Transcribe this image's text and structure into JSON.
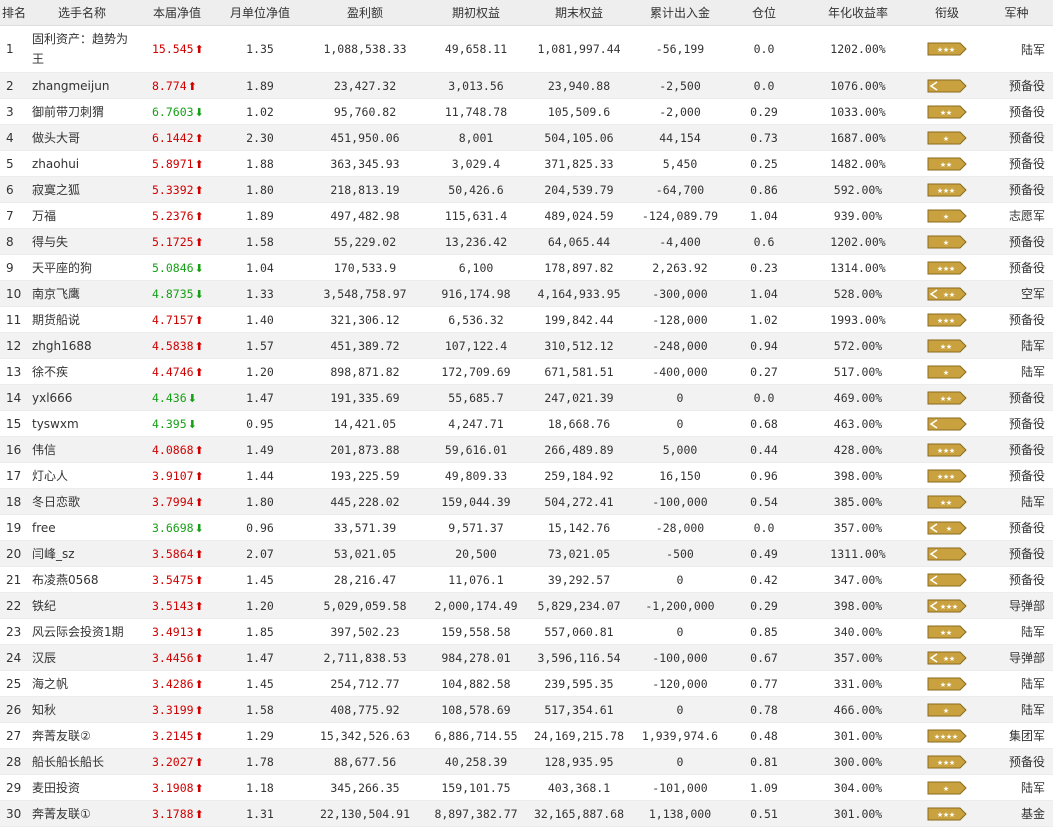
{
  "headers": [
    "排名",
    "选手名称",
    "本届净值",
    "月单位净值",
    "盈利额",
    "期初权益",
    "期末权益",
    "累计出入金",
    "仓位",
    "年化收益率",
    "衔级",
    "军种"
  ],
  "colors": {
    "up": "#d00000",
    "down": "#16a016",
    "badge_fill": "#c9a23f",
    "badge_edge": "#8a6a1f"
  },
  "rows": [
    {
      "rank": "1",
      "name": "固利资产：趋势为王",
      "nav": "15.545",
      "dir": "up",
      "monthly": "1.35",
      "profit": "1,088,538.33",
      "start": "49,658.11",
      "end": "1,081,997.44",
      "flow": "-56,199",
      "position": "0.0",
      "annual": "1202.00%",
      "insignia": {
        "chevron": false,
        "stars": 3
      },
      "arm": "陆军"
    },
    {
      "rank": "2",
      "name": "zhangmeijun",
      "nav": "8.774",
      "dir": "up",
      "monthly": "1.89",
      "profit": "23,427.32",
      "start": "3,013.56",
      "end": "23,940.88",
      "flow": "-2,500",
      "position": "0.0",
      "annual": "1076.00%",
      "insignia": {
        "chevron": true,
        "stars": 0
      },
      "arm": "预备役"
    },
    {
      "rank": "3",
      "name": "御前带刀刺猬",
      "nav": "6.7603",
      "dir": "down",
      "monthly": "1.02",
      "profit": "95,760.82",
      "start": "11,748.78",
      "end": "105,509.6",
      "flow": "-2,000",
      "position": "0.29",
      "annual": "1033.00%",
      "insignia": {
        "chevron": false,
        "stars": 2
      },
      "arm": "预备役"
    },
    {
      "rank": "4",
      "name": "做头大哥",
      "nav": "6.1442",
      "dir": "up",
      "monthly": "2.30",
      "profit": "451,950.06",
      "start": "8,001",
      "end": "504,105.06",
      "flow": "44,154",
      "position": "0.73",
      "annual": "1687.00%",
      "insignia": {
        "chevron": false,
        "stars": 1
      },
      "arm": "预备役"
    },
    {
      "rank": "5",
      "name": "zhaohui",
      "nav": "5.8971",
      "dir": "up",
      "monthly": "1.88",
      "profit": "363,345.93",
      "start": "3,029.4",
      "end": "371,825.33",
      "flow": "5,450",
      "position": "0.25",
      "annual": "1482.00%",
      "insignia": {
        "chevron": false,
        "stars": 2
      },
      "arm": "预备役"
    },
    {
      "rank": "6",
      "name": "寂寞之狐",
      "nav": "5.3392",
      "dir": "up",
      "monthly": "1.80",
      "profit": "218,813.19",
      "start": "50,426.6",
      "end": "204,539.79",
      "flow": "-64,700",
      "position": "0.86",
      "annual": "592.00%",
      "insignia": {
        "chevron": false,
        "stars": 3
      },
      "arm": "预备役"
    },
    {
      "rank": "7",
      "name": "万福",
      "nav": "5.2376",
      "dir": "up",
      "monthly": "1.89",
      "profit": "497,482.98",
      "start": "115,631.4",
      "end": "489,024.59",
      "flow": "-124,089.79",
      "position": "1.04",
      "annual": "939.00%",
      "insignia": {
        "chevron": false,
        "stars": 1
      },
      "arm": "志愿军"
    },
    {
      "rank": "8",
      "name": "得与失",
      "nav": "5.1725",
      "dir": "up",
      "monthly": "1.58",
      "profit": "55,229.02",
      "start": "13,236.42",
      "end": "64,065.44",
      "flow": "-4,400",
      "position": "0.6",
      "annual": "1202.00%",
      "insignia": {
        "chevron": false,
        "stars": 1
      },
      "arm": "预备役"
    },
    {
      "rank": "9",
      "name": "天平座的狗",
      "nav": "5.0846",
      "dir": "down",
      "monthly": "1.04",
      "profit": "170,533.9",
      "start": "6,100",
      "end": "178,897.82",
      "flow": "2,263.92",
      "position": "0.23",
      "annual": "1314.00%",
      "insignia": {
        "chevron": false,
        "stars": 3
      },
      "arm": "预备役"
    },
    {
      "rank": "10",
      "name": "南京飞鹰",
      "nav": "4.8735",
      "dir": "down",
      "monthly": "1.33",
      "profit": "3,548,758.97",
      "start": "916,174.98",
      "end": "4,164,933.95",
      "flow": "-300,000",
      "position": "1.04",
      "annual": "528.00%",
      "insignia": {
        "chevron": true,
        "stars": 2
      },
      "arm": "空军"
    },
    {
      "rank": "11",
      "name": "期货船说",
      "nav": "4.7157",
      "dir": "up",
      "monthly": "1.40",
      "profit": "321,306.12",
      "start": "6,536.32",
      "end": "199,842.44",
      "flow": "-128,000",
      "position": "1.02",
      "annual": "1993.00%",
      "insignia": {
        "chevron": false,
        "stars": 3
      },
      "arm": "预备役"
    },
    {
      "rank": "12",
      "name": "zhgh1688",
      "nav": "4.5838",
      "dir": "up",
      "monthly": "1.57",
      "profit": "451,389.72",
      "start": "107,122.4",
      "end": "310,512.12",
      "flow": "-248,000",
      "position": "0.94",
      "annual": "572.00%",
      "insignia": {
        "chevron": false,
        "stars": 2
      },
      "arm": "陆军"
    },
    {
      "rank": "13",
      "name": "徐不疾",
      "nav": "4.4746",
      "dir": "up",
      "monthly": "1.20",
      "profit": "898,871.82",
      "start": "172,709.69",
      "end": "671,581.51",
      "flow": "-400,000",
      "position": "0.27",
      "annual": "517.00%",
      "insignia": {
        "chevron": false,
        "stars": 1
      },
      "arm": "陆军"
    },
    {
      "rank": "14",
      "name": "yxl666",
      "nav": "4.436",
      "dir": "down",
      "monthly": "1.47",
      "profit": "191,335.69",
      "start": "55,685.7",
      "end": "247,021.39",
      "flow": "0",
      "position": "0.0",
      "annual": "469.00%",
      "insignia": {
        "chevron": false,
        "stars": 2
      },
      "arm": "预备役"
    },
    {
      "rank": "15",
      "name": "tyswxm",
      "nav": "4.395",
      "dir": "down",
      "monthly": "0.95",
      "profit": "14,421.05",
      "start": "4,247.71",
      "end": "18,668.76",
      "flow": "0",
      "position": "0.68",
      "annual": "463.00%",
      "insignia": {
        "chevron": true,
        "stars": 0
      },
      "arm": "预备役"
    },
    {
      "rank": "16",
      "name": "伟信",
      "nav": "4.0868",
      "dir": "up",
      "monthly": "1.49",
      "profit": "201,873.88",
      "start": "59,616.01",
      "end": "266,489.89",
      "flow": "5,000",
      "position": "0.44",
      "annual": "428.00%",
      "insignia": {
        "chevron": false,
        "stars": 3
      },
      "arm": "预备役"
    },
    {
      "rank": "17",
      "name": "灯心人",
      "nav": "3.9107",
      "dir": "up",
      "monthly": "1.44",
      "profit": "193,225.59",
      "start": "49,809.33",
      "end": "259,184.92",
      "flow": "16,150",
      "position": "0.96",
      "annual": "398.00%",
      "insignia": {
        "chevron": false,
        "stars": 3
      },
      "arm": "预备役"
    },
    {
      "rank": "18",
      "name": "冬日恋歌",
      "nav": "3.7994",
      "dir": "up",
      "monthly": "1.80",
      "profit": "445,228.02",
      "start": "159,044.39",
      "end": "504,272.41",
      "flow": "-100,000",
      "position": "0.54",
      "annual": "385.00%",
      "insignia": {
        "chevron": false,
        "stars": 2
      },
      "arm": "陆军"
    },
    {
      "rank": "19",
      "name": "free",
      "nav": "3.6698",
      "dir": "down",
      "monthly": "0.96",
      "profit": "33,571.39",
      "start": "9,571.37",
      "end": "15,142.76",
      "flow": "-28,000",
      "position": "0.0",
      "annual": "357.00%",
      "insignia": {
        "chevron": true,
        "stars": 1
      },
      "arm": "预备役"
    },
    {
      "rank": "20",
      "name": "闫峰_sz",
      "nav": "3.5864",
      "dir": "up",
      "monthly": "2.07",
      "profit": "53,021.05",
      "start": "20,500",
      "end": "73,021.05",
      "flow": "-500",
      "position": "0.49",
      "annual": "1311.00%",
      "insignia": {
        "chevron": true,
        "stars": 0
      },
      "arm": "预备役"
    },
    {
      "rank": "21",
      "name": "布凌燕0568",
      "nav": "3.5475",
      "dir": "up",
      "monthly": "1.45",
      "profit": "28,216.47",
      "start": "11,076.1",
      "end": "39,292.57",
      "flow": "0",
      "position": "0.42",
      "annual": "347.00%",
      "insignia": {
        "chevron": true,
        "stars": 0
      },
      "arm": "预备役"
    },
    {
      "rank": "22",
      "name": "铁纪",
      "nav": "3.5143",
      "dir": "up",
      "monthly": "1.20",
      "profit": "5,029,059.58",
      "start": "2,000,174.49",
      "end": "5,829,234.07",
      "flow": "-1,200,000",
      "position": "0.29",
      "annual": "398.00%",
      "insignia": {
        "chevron": true,
        "stars": 3
      },
      "arm": "导弹部"
    },
    {
      "rank": "23",
      "name": "风云际会投资1期",
      "nav": "3.4913",
      "dir": "up",
      "monthly": "1.85",
      "profit": "397,502.23",
      "start": "159,558.58",
      "end": "557,060.81",
      "flow": "0",
      "position": "0.85",
      "annual": "340.00%",
      "insignia": {
        "chevron": false,
        "stars": 2
      },
      "arm": "陆军"
    },
    {
      "rank": "24",
      "name": "汉辰",
      "nav": "3.4456",
      "dir": "up",
      "monthly": "1.47",
      "profit": "2,711,838.53",
      "start": "984,278.01",
      "end": "3,596,116.54",
      "flow": "-100,000",
      "position": "0.67",
      "annual": "357.00%",
      "insignia": {
        "chevron": true,
        "stars": 2
      },
      "arm": "导弹部"
    },
    {
      "rank": "25",
      "name": "海之帆",
      "nav": "3.4286",
      "dir": "up",
      "monthly": "1.45",
      "profit": "254,712.77",
      "start": "104,882.58",
      "end": "239,595.35",
      "flow": "-120,000",
      "position": "0.77",
      "annual": "331.00%",
      "insignia": {
        "chevron": false,
        "stars": 2
      },
      "arm": "陆军"
    },
    {
      "rank": "26",
      "name": "知秋",
      "nav": "3.3199",
      "dir": "up",
      "monthly": "1.58",
      "profit": "408,775.92",
      "start": "108,578.69",
      "end": "517,354.61",
      "flow": "0",
      "position": "0.78",
      "annual": "466.00%",
      "insignia": {
        "chevron": false,
        "stars": 1
      },
      "arm": "陆军"
    },
    {
      "rank": "27",
      "name": "奔菁友联②",
      "nav": "3.2145",
      "dir": "up",
      "monthly": "1.29",
      "profit": "15,342,526.63",
      "start": "6,886,714.55",
      "end": "24,169,215.78",
      "flow": "1,939,974.6",
      "position": "0.48",
      "annual": "301.00%",
      "insignia": {
        "chevron": false,
        "stars": 4
      },
      "arm": "集团军"
    },
    {
      "rank": "28",
      "name": "船长船长船长",
      "nav": "3.2027",
      "dir": "up",
      "monthly": "1.78",
      "profit": "88,677.56",
      "start": "40,258.39",
      "end": "128,935.95",
      "flow": "0",
      "position": "0.81",
      "annual": "300.00%",
      "insignia": {
        "chevron": false,
        "stars": 3
      },
      "arm": "预备役"
    },
    {
      "rank": "29",
      "name": "麦田投资",
      "nav": "3.1908",
      "dir": "up",
      "monthly": "1.18",
      "profit": "345,266.35",
      "start": "159,101.75",
      "end": "403,368.1",
      "flow": "-101,000",
      "position": "1.09",
      "annual": "304.00%",
      "insignia": {
        "chevron": false,
        "stars": 1
      },
      "arm": "陆军"
    },
    {
      "rank": "30",
      "name": "奔菁友联①",
      "nav": "3.1788",
      "dir": "up",
      "monthly": "1.31",
      "profit": "22,130,504.91",
      "start": "8,897,382.77",
      "end": "32,165,887.68",
      "flow": "1,138,000",
      "position": "0.51",
      "annual": "301.00%",
      "insignia": {
        "chevron": false,
        "stars": 3
      },
      "arm": "基金"
    }
  ]
}
